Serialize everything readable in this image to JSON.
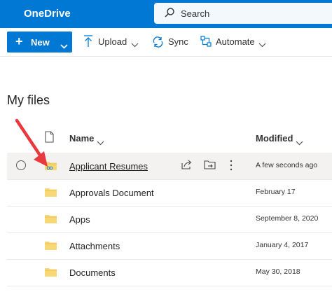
{
  "app": {
    "name": "OneDrive"
  },
  "search": {
    "placeholder": "Search"
  },
  "command_bar": {
    "new_label": "New",
    "upload_label": "Upload",
    "sync_label": "Sync",
    "automate_label": "Automate"
  },
  "page": {
    "title": "My files"
  },
  "columns": {
    "name": "Name",
    "modified": "Modified"
  },
  "files": [
    {
      "name": "Applicant Resumes",
      "modified": "A few seconds ago",
      "selected": true
    },
    {
      "name": "Approvals Document",
      "modified": "February 17"
    },
    {
      "name": "Apps",
      "modified": "September 8, 2020"
    },
    {
      "name": "Attachments",
      "modified": "January 4, 2017"
    },
    {
      "name": "Documents",
      "modified": "May 30, 2018"
    }
  ],
  "colors": {
    "brand": "#0078d4",
    "folder": "#f8d775",
    "arrow": "#e8393f"
  }
}
